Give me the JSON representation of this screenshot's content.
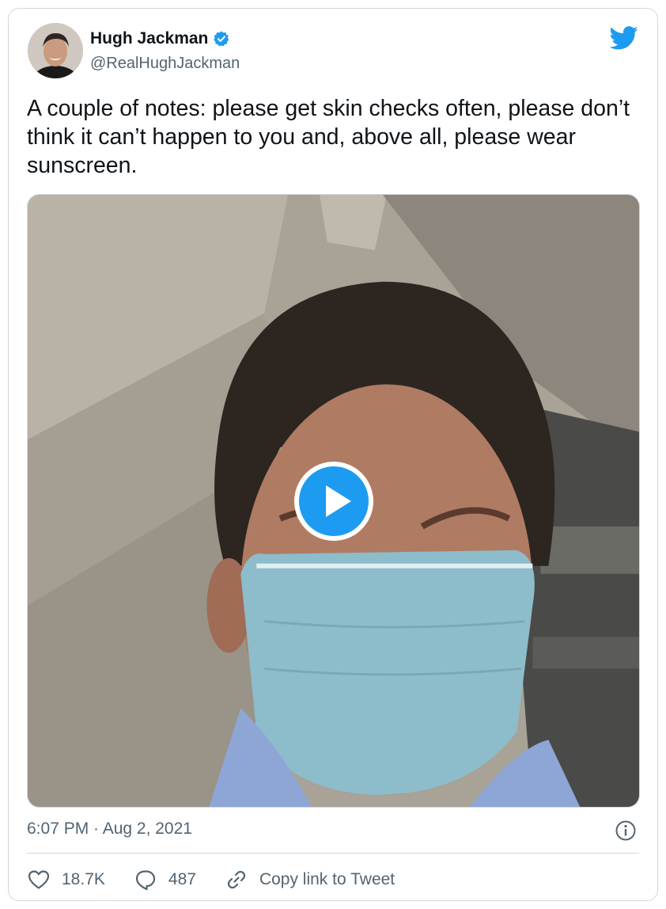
{
  "tweet": {
    "author": {
      "name": "Hugh Jackman",
      "handle": "@RealHughJackman",
      "verified": true
    },
    "text": "A couple of notes: please get skin checks often, please don’t think it can’t happen to you and, above all, please wear sunscreen.",
    "media": {
      "type": "video",
      "play_icon": "play-icon"
    },
    "timestamp": "6:07 PM · Aug 2, 2021",
    "actions": {
      "likes": "18.7K",
      "replies": "487",
      "copy_link_label": "Copy link to Tweet"
    }
  },
  "icons": {
    "brand": "twitter-bird-icon",
    "verified": "verified-badge-icon",
    "info": "info-icon",
    "like": "heart-icon",
    "reply": "reply-bubble-icon",
    "link": "link-icon"
  },
  "colors": {
    "accent": "#1d9bf0",
    "text_primary": "#0f1419",
    "text_secondary": "#536471",
    "border": "#cfd9de"
  }
}
